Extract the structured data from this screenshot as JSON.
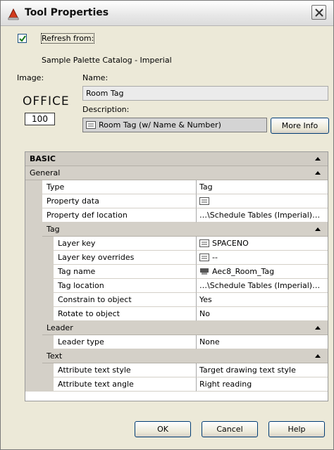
{
  "window": {
    "title": "Tool Properties"
  },
  "refresh": {
    "label": "Refresh from:",
    "checked": true,
    "catalog": "Sample Palette Catalog - Imperial"
  },
  "image": {
    "label": "Image:",
    "office_text": "OFFICE",
    "office_number": "100"
  },
  "name": {
    "label": "Name:",
    "value": "Room Tag"
  },
  "description": {
    "label": "Description:",
    "value": "Room Tag (w/ Name & Number)"
  },
  "buttons": {
    "more_info": "More Info",
    "ok": "OK",
    "cancel": "Cancel",
    "help": "Help"
  },
  "grid": {
    "basic": "BASIC",
    "general": {
      "label": "General",
      "rows": [
        {
          "name": "Type",
          "value": "Tag"
        },
        {
          "name": "Property data",
          "value": "",
          "icon": "list-icon"
        },
        {
          "name": "Property def location",
          "value": "…\\Schedule Tables (Imperial)…"
        }
      ]
    },
    "tag": {
      "label": "Tag",
      "rows": [
        {
          "name": "Layer key",
          "value": "SPACENO",
          "icon": "list-icon"
        },
        {
          "name": "Layer key overrides",
          "value": "--",
          "icon": "list-icon"
        },
        {
          "name": "Tag name",
          "value": "Aec8_Room_Tag",
          "icon": "tag-block-icon"
        },
        {
          "name": "Tag location",
          "value": "…\\Schedule Tables (Imperial)…"
        },
        {
          "name": "Constrain to object",
          "value": "Yes"
        },
        {
          "name": "Rotate to object",
          "value": "No"
        }
      ]
    },
    "leader": {
      "label": "Leader",
      "rows": [
        {
          "name": "Leader type",
          "value": "None"
        }
      ]
    },
    "text": {
      "label": "Text",
      "rows": [
        {
          "name": "Attribute text style",
          "value": "Target drawing text style"
        },
        {
          "name": "Attribute text angle",
          "value": "Right reading"
        }
      ]
    }
  }
}
